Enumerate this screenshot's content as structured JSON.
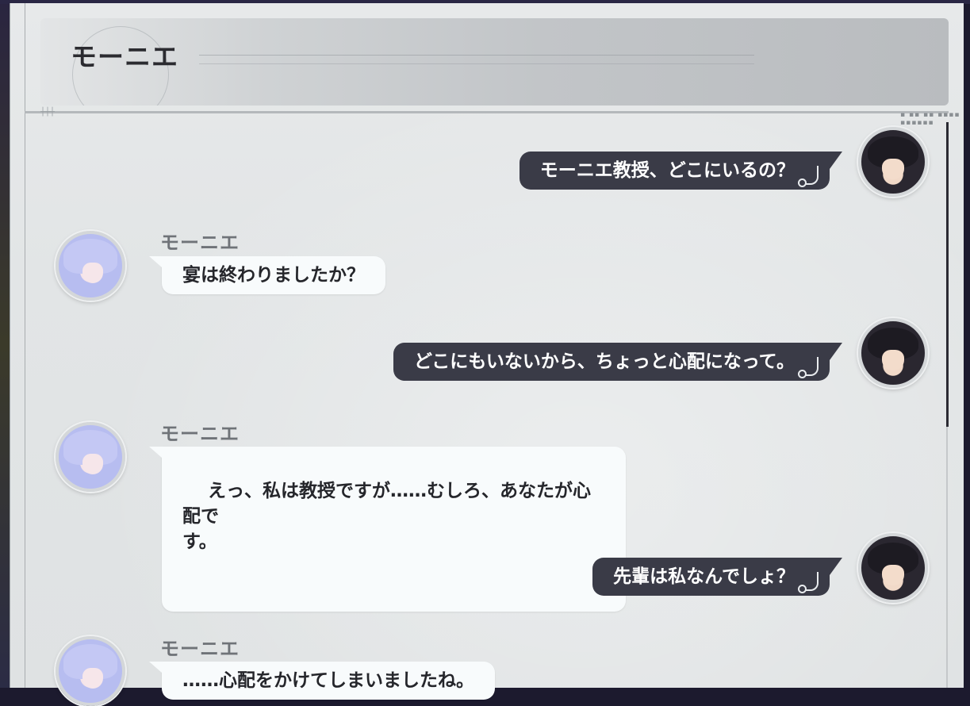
{
  "header": {
    "title": "モーニエ"
  },
  "messages": [
    {
      "side": "right",
      "speaker": "",
      "text": "モーニエ教授、どこにいるの？"
    },
    {
      "side": "left",
      "speaker": "モーニエ",
      "text": "宴は終わりましたか？"
    },
    {
      "side": "right",
      "speaker": "",
      "text": "どこにもいないから、ちょっと心配になって。"
    },
    {
      "side": "left",
      "speaker": "モーニエ",
      "text": "えっ、私は教授ですが……むしろ、あなたが心配で\nす。"
    },
    {
      "side": "right",
      "speaker": "",
      "text": "先輩は私なんでしょ？"
    },
    {
      "side": "left",
      "speaker": "モーニエ",
      "text": "……心配をかけてしまいましたね。"
    }
  ],
  "icons": {
    "player_avatar": "player-avatar-icon",
    "npc_avatar": "monie-avatar-icon",
    "bubble_deco": "hook-deco-icon"
  },
  "colors": {
    "player_bubble": "#3a3b47",
    "npc_bubble": "#f8fbfc",
    "panel": "#e4e7e8",
    "speaker_name": "#6f7378"
  }
}
